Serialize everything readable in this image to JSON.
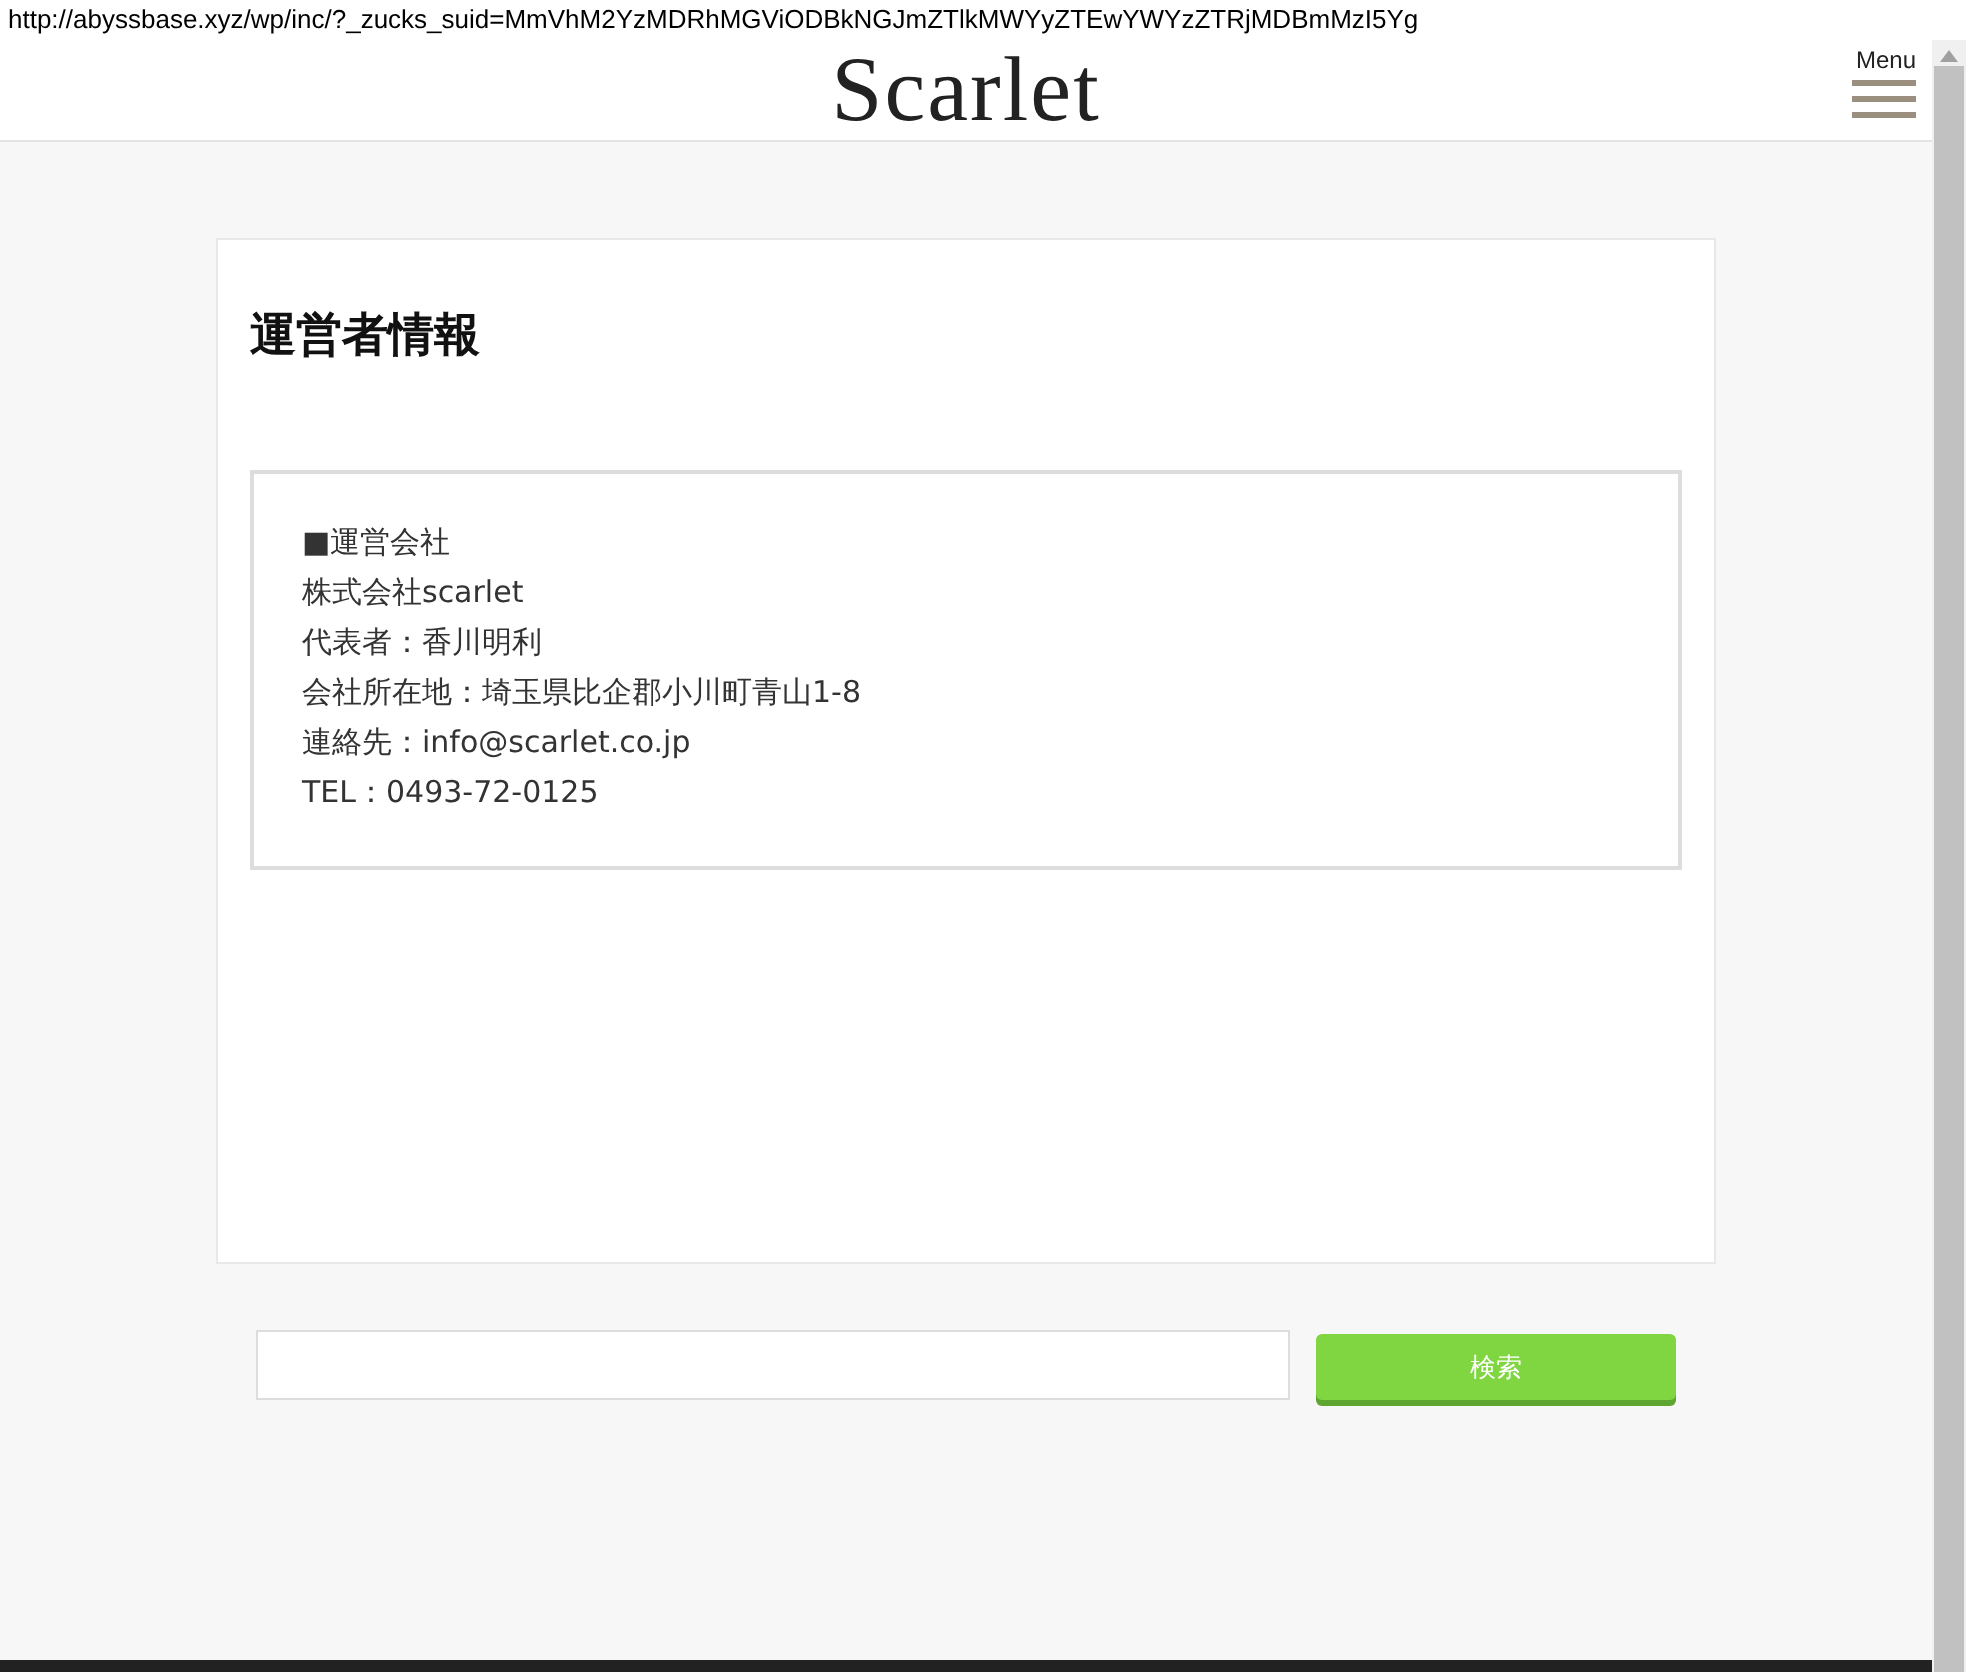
{
  "url": "http://abyssbase.xyz/wp/inc/?_zucks_suid=MmVhM2YzMDRhMGViODBkNGJmZTlkMWYyZTEwYWYzZTRjMDBmMzI5Yg",
  "header": {
    "logo": "Scarlet",
    "menu_label": "Menu"
  },
  "page": {
    "title": "運営者情報",
    "info_lines": [
      "■運営会社",
      "株式会社scarlet",
      "代表者：香川明利",
      "会社所在地：埼玉県比企郡小川町青山1-8",
      "連絡先：info@scarlet.co.jp",
      "TEL：0493-72-0125"
    ]
  },
  "search": {
    "button": "検索"
  }
}
